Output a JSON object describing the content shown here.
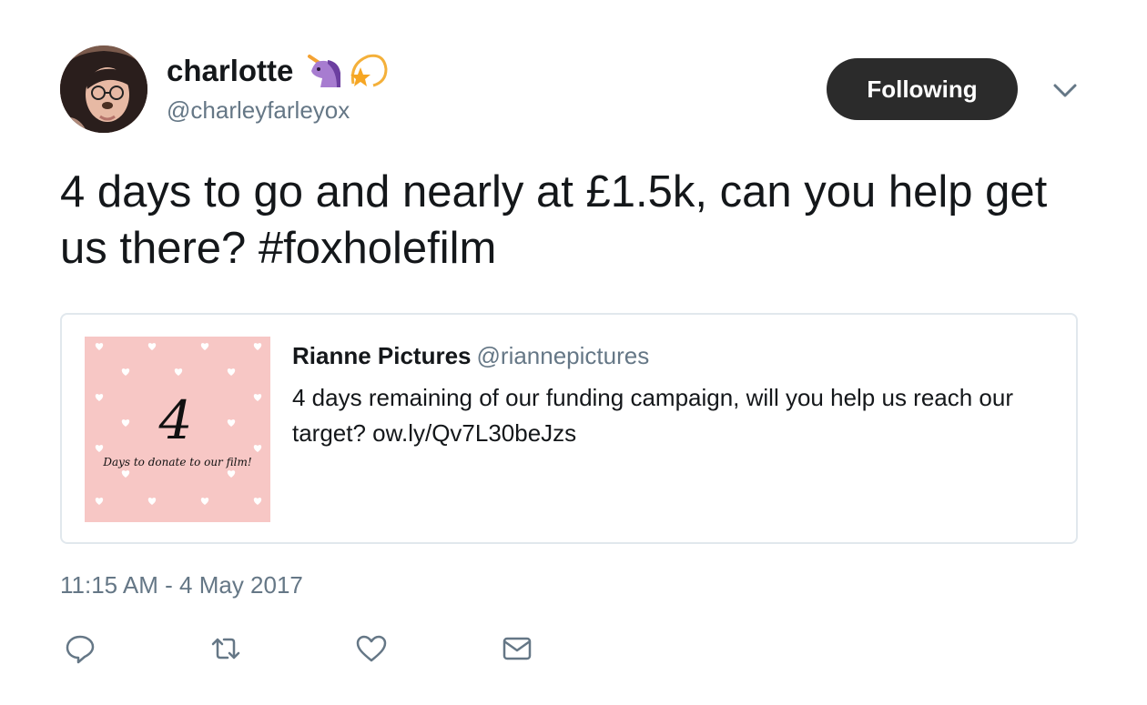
{
  "author": {
    "display_name": "charlotte",
    "handle": "@charleyfarleyox",
    "emojis": [
      "unicorn-icon",
      "dizzy-star-icon"
    ]
  },
  "follow_button": {
    "label": "Following"
  },
  "tweet": {
    "text": "4 days to go and nearly at £1.5k, can you help get us there? #foxholefilm",
    "timestamp": "11:15 AM - 4 May 2017"
  },
  "quoted": {
    "name": "Rianne Pictures",
    "handle": "@riannepictures",
    "text": "4 days remaining of our funding campaign, will you help us reach our target? ow.ly/Qv7L30beJzs",
    "image": {
      "big_number": "4",
      "caption": "Days to donate to our film!"
    }
  },
  "actions": [
    "reply-icon",
    "retweet-icon",
    "like-icon",
    "message-icon"
  ],
  "colors": {
    "text": "#14171a",
    "muted": "#657786",
    "button_bg": "#2b2b2b",
    "border": "#e1e8ed",
    "quote_image_bg": "#f7c7c5"
  }
}
